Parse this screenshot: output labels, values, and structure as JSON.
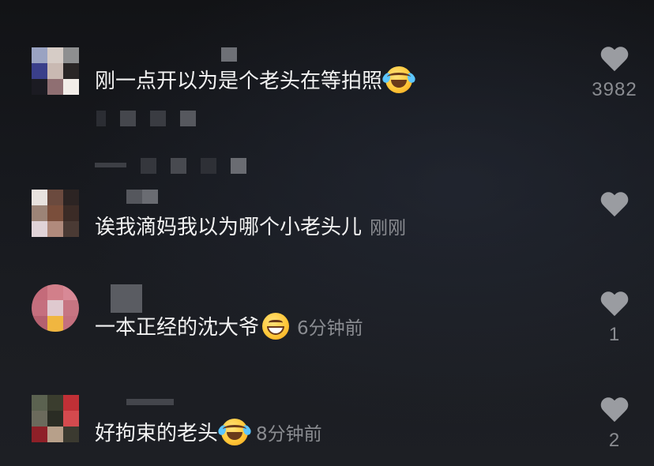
{
  "comments": [
    {
      "text": "刚一点开以为是个老头在等拍照",
      "emoji": "rolling-on-floor-laughing",
      "time": "",
      "likes": "3982"
    },
    {
      "text": "诶我滴妈我以为哪个小老头儿",
      "emoji": "",
      "time": "刚刚",
      "likes": ""
    },
    {
      "text": "一本正经的沈大爷",
      "emoji": "grinning-face",
      "time": "6分钟前",
      "likes": "1"
    },
    {
      "text": "好拘束的老头",
      "emoji": "rolling-on-floor-laughing",
      "time": "8分钟前",
      "likes": "2"
    }
  ],
  "colors": {
    "background": "#16181c",
    "text": "#f2f2f2",
    "muted": "#8a8c91",
    "heart": "#9a9ca1"
  }
}
